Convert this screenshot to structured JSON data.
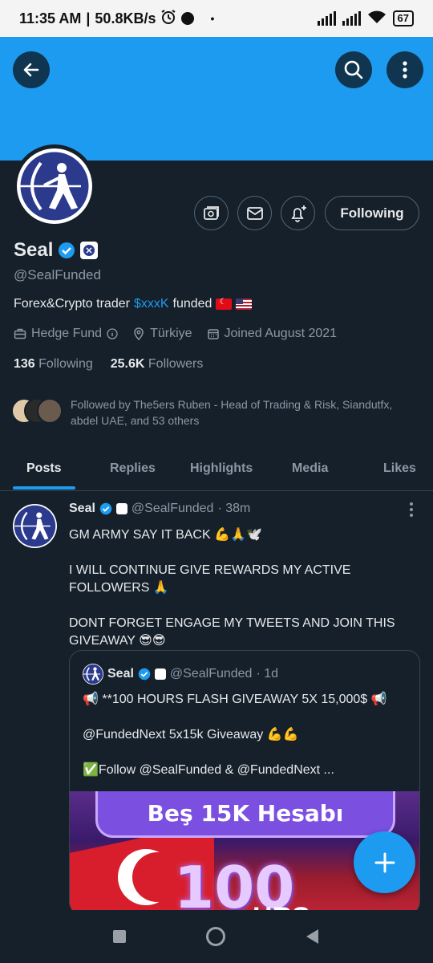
{
  "status_bar": {
    "time": "11:35 AM",
    "speed": "50.8KB/s",
    "battery": "67"
  },
  "colors": {
    "accent": "#1d9bf0",
    "background": "#15202b",
    "muted": "#8b98a5",
    "border": "#38444d"
  },
  "header": {
    "back_icon": "arrow-left-icon",
    "search_icon": "search-icon",
    "more_icon": "more-vertical-icon"
  },
  "profile": {
    "name": "Seal",
    "handle": "@SealFunded",
    "bio_before": "Forex&Crypto trader",
    "bio_link": "$xxxK",
    "bio_after": "funded",
    "category": "Hedge Fund",
    "location": "Türkiye",
    "joined": "Joined August 2021",
    "following_count": "136",
    "following_label": "Following",
    "followers_count": "25.6K",
    "followers_label": "Followers",
    "followed_by": "Followed by The5ers Ruben - Head of Trading & Risk, Siandutfx, abdel UAE, and 53 others",
    "follow_button": "Following"
  },
  "tabs": [
    "Posts",
    "Replies",
    "Highlights",
    "Media",
    "Likes"
  ],
  "tweet": {
    "name": "Seal",
    "handle": "@SealFunded",
    "time": "· 38m",
    "lines": [
      "GM ARMY SAY IT BACK 💪🙏🕊️",
      "",
      "I WILL CONTINUE GIVE REWARDS MY ACTIVE FOLLOWERS 🙏",
      "",
      "DONT FORGET ENGAGE MY TWEETS AND JOIN THIS GIVEAWAY 😎😎"
    ]
  },
  "quote": {
    "name": "Seal",
    "handle": "@SealFunded",
    "time": "· 1d",
    "line1": "📢 **100 HOURS FLASH GIVEAWAY 5X 15,000$ 📢",
    "line2": "@FundedNext 5x15k Giveaway 💪💪",
    "line3": "✅Follow @SealFunded & @FundedNext ...",
    "image_title": "Beş 15K Hesabı",
    "image_number": "100",
    "image_word": "HRS"
  }
}
